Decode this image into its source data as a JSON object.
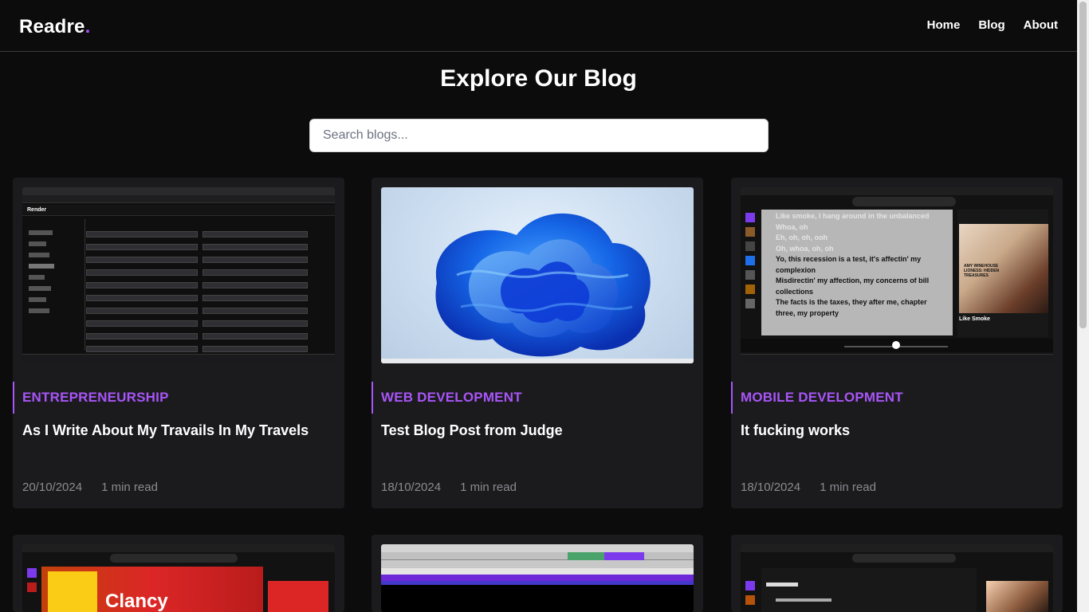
{
  "nav": {
    "brand": "Readre",
    "brand_dot": ".",
    "links": [
      "Home",
      "Blog",
      "About"
    ]
  },
  "page": {
    "title": "Explore Our Blog",
    "search_placeholder": "Search blogs..."
  },
  "posts": [
    {
      "category": "ENTREPRENEURSHIP",
      "title": "As I Write About My Travails In My Travels",
      "date": "20/10/2024",
      "read": "1 min read"
    },
    {
      "category": "WEB DEVELOPMENT",
      "title": "Test Blog Post from Judge",
      "date": "18/10/2024",
      "read": "1 min read"
    },
    {
      "category": "MOBILE DEVELOPMENT",
      "title": "It fucking works",
      "date": "18/10/2024",
      "read": "1 min read"
    }
  ],
  "thumbs": {
    "lyrics": [
      "Like smoke, I hang around in the unbalanced",
      "Whoa, oh",
      "Eh, oh, oh, ooh",
      "Oh, whoa, oh, oh",
      "Yo, this recession is a test, it's affectin' my complexion",
      "Misdirectin' my affection, my concerns of bill collections",
      "The facts is the taxes, they after me, chapter three, my property"
    ],
    "album_artist": "AMY WINEHOUSE",
    "album_title": "LIONESS: HIDDEN TREASURES",
    "track_title": "Like Smoke",
    "clancy": "Clancy",
    "render_brand": "Render"
  },
  "colors": {
    "accent": "#a855f7",
    "background": "#0c0c0d",
    "card": "#1b1b1e"
  }
}
